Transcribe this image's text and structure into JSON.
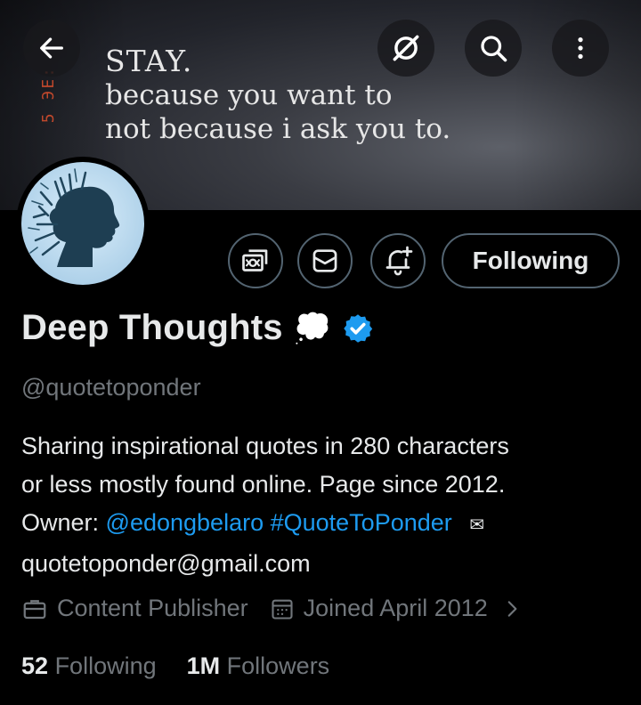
{
  "banner": {
    "side_text": "5 ЭE: ",
    "quote_lines": [
      "STAY.",
      "because you want to",
      "not because i ask you to."
    ]
  },
  "nav": {
    "back_icon": "arrow-left-icon",
    "grok_icon": "slash-circle-icon",
    "search_icon": "search-icon",
    "more_icon": "more-vertical-icon"
  },
  "actions": {
    "tip_icon": "tip-money-icon",
    "message_icon": "envelope-icon",
    "notify_icon": "bell-plus-icon",
    "following_label": "Following"
  },
  "profile": {
    "name": "Deep Thoughts",
    "name_emoji": "💭",
    "verified": true,
    "accent_color": "#1d9bf0",
    "handle": "@quotetoponder",
    "bio_line1": "Sharing inspirational quotes in 280 characters",
    "bio_line2": "or less mostly found online. Page since 2012.",
    "owner_label": "Owner:",
    "owner_handle": "@edongbelaro",
    "hashtag": "#QuoteToPonder",
    "email_emoji": "✉",
    "email": "quotetoponder@gmail.com",
    "category": "Content Publisher",
    "joined": "Joined April 2012"
  },
  "stats": {
    "following_count": "52",
    "following_label": "Following",
    "followers_count": "1M",
    "followers_label": "Followers"
  }
}
